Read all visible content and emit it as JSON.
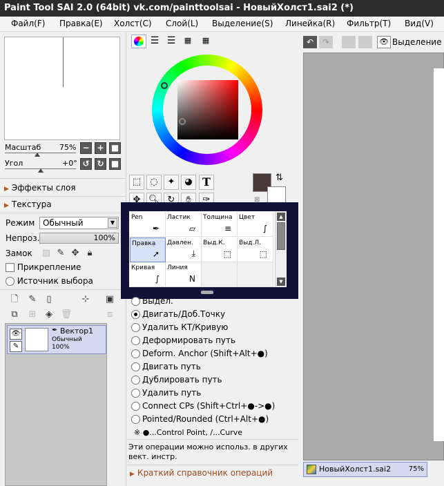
{
  "title": "Paint Tool SAI 2.0 (64bit) vk.com/painttoolsai - НовыйХолст1.sai2 (*)",
  "menu": [
    "Файл(F)",
    "Правка(E)",
    "Холст(C)",
    "Слой(L)",
    "Выделение(S)",
    "Линейка(R)",
    "Фильтр(T)",
    "Вид(V)"
  ],
  "navigator": {
    "zoom_label": "Масштаб",
    "zoom_value": "75%",
    "angle_label": "Угол",
    "angle_value": "+0°"
  },
  "sections": {
    "layer_effects": "Эффекты слоя",
    "texture": "Текстура"
  },
  "layer_props": {
    "mode_label": "Режим",
    "mode_value": "Обычный",
    "opacity_label": "Непроз.",
    "opacity_value": "100%",
    "lock_label": "Замок",
    "clip_label": "Прикрепление",
    "source_label": "Источник выбора"
  },
  "layer": {
    "name": "Вектор1",
    "mode": "Обычный",
    "opacity": "100%"
  },
  "tools": {
    "text_tool": "T"
  },
  "brush_grid": [
    {
      "label": "Pen",
      "icon": "pen-icon"
    },
    {
      "label": "Ластик",
      "icon": "eraser-icon"
    },
    {
      "label": "Толщина",
      "icon": "thickness-icon"
    },
    {
      "label": "Цвет",
      "icon": "color-curve-icon"
    },
    {
      "label": "Правка",
      "icon": "cursor-icon"
    },
    {
      "label": "Давлен.",
      "icon": "pressure-icon"
    },
    {
      "label": "Выд.К.",
      "icon": "select-stroke-icon"
    },
    {
      "label": "Выд.Л.",
      "icon": "select-line-icon"
    },
    {
      "label": "Кривая",
      "icon": "curve-icon"
    },
    {
      "label": "Линия",
      "icon": "polyline-icon"
    }
  ],
  "edit_options": [
    {
      "label": "Выдел.",
      "selected": false
    },
    {
      "label": "Двигать/Доб.Точку",
      "selected": true
    },
    {
      "label": "Удалить КТ/Кривую",
      "selected": false
    },
    {
      "label": "Деформировать путь",
      "selected": false
    },
    {
      "label": "Deform. Anchor (Shift+Alt+●)",
      "selected": false
    },
    {
      "label": "Двигать путь",
      "selected": false
    },
    {
      "label": "Дублировать путь",
      "selected": false
    },
    {
      "label": "Удалить путь",
      "selected": false
    },
    {
      "label": "Connect CPs (Shift+Ctrl+●->●)",
      "selected": false
    },
    {
      "label": "Pointed/Rounded (Ctrl+Alt+●)",
      "selected": false
    }
  ],
  "note": "※ ●...Control Point, /...Curve",
  "info_text": "Эти операции можно использ. в других вект. инстр.",
  "quick_ref": "Краткий справочник операций",
  "view_toolbar": {
    "selection_label": "Выделение"
  },
  "canvas_tab": {
    "name": "НовыйХолст1.sai2",
    "zoom": "75%"
  },
  "colors": {
    "titlebar": "#2b2b2b",
    "current_color": "#4a3838",
    "popup_frame": "#13133a",
    "selected_cell": "#d9e3f7"
  }
}
